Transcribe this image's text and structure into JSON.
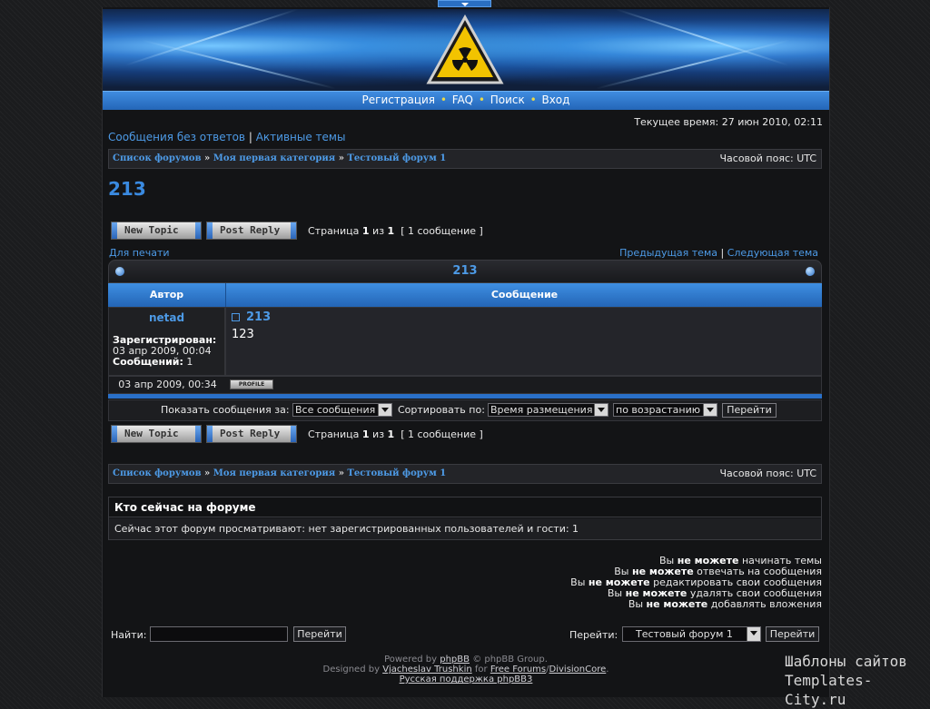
{
  "nav": {
    "register": "Регистрация",
    "faq": "FAQ",
    "search": "Поиск",
    "login": "Вход",
    "sep": "•"
  },
  "time": "Текущее время: 27 июн 2010, 02:11",
  "quick_links": {
    "unanswered": "Сообщения без ответов",
    "active": "Активные темы",
    "sep": "|"
  },
  "breadcrumb": {
    "items": [
      "Список форумов",
      "Моя первая категория",
      "Тестовый форум 1"
    ],
    "sep": "»",
    "timezone": "Часовой пояс: UTC"
  },
  "topic_title": "213",
  "buttons": {
    "new_topic": "New Topic",
    "post_reply": "Post Reply"
  },
  "pagination": {
    "page_word": "Страница",
    "current": "1",
    "of_word": "из",
    "total": "1",
    "count": "[ 1 сообщение ]"
  },
  "print_link": "Для печати",
  "topic_nav": {
    "prev": "Предыдущая тема",
    "sep": "|",
    "next": "Следующая тема"
  },
  "topic_table": {
    "header": "213",
    "col_author": "Автор",
    "col_message": "Сообщение"
  },
  "post": {
    "author": "netad",
    "registered_label": "Зарегистрирован:",
    "registered_value": "03 апр 2009, 00:04",
    "posts_label": "Сообщений:",
    "posts_value": "1",
    "subject": "213",
    "body": "123",
    "date": "03 апр 2009, 00:34",
    "profile_btn": "PROFILE"
  },
  "filters": {
    "show_label": "Показать сообщения за:",
    "show_value": "Все сообщения",
    "sort_label": "Сортировать по:",
    "sort_value": "Время размещения",
    "order_value": "по возрастанию",
    "go": "Перейти"
  },
  "online": {
    "title": "Кто сейчас на форуме",
    "text": "Сейчас этот форум просматривают: нет зарегистрированных пользователей и гости: 1"
  },
  "permissions": [
    {
      "pre": "Вы",
      "bold": "не можете",
      "post": "начинать темы"
    },
    {
      "pre": "Вы",
      "bold": "не можете",
      "post": "отвечать на сообщения"
    },
    {
      "pre": "Вы",
      "bold": "не можете",
      "post": "редактировать свои сообщения"
    },
    {
      "pre": "Вы",
      "bold": "не можете",
      "post": "удалять свои сообщения"
    },
    {
      "pre": "Вы",
      "bold": "не можете",
      "post": "добавлять вложения"
    }
  ],
  "search": {
    "label": "Найти:",
    "value": "",
    "button": "Перейти"
  },
  "jump": {
    "label": "Перейти:",
    "value": "Тестовый форум 1",
    "button": "Перейти"
  },
  "footer": {
    "powered_pre": "Powered by",
    "phpbb": "phpBB",
    "powered_post": "© phpBB Group.",
    "designed_pre": "Designed by",
    "designer": "Vjacheslav Trushkin",
    "for_word": "for",
    "free_forums": "Free Forums",
    "slash": "/",
    "division": "DivisionCore",
    "dot": ".",
    "support": "Русская поддержка phpBB3"
  },
  "watermark": {
    "line1": "Шаблоны сайтов",
    "line2": "Templates-City.ru"
  },
  "colors": {
    "accent": "#2a70c8",
    "link": "#4d9ae6",
    "page_bg": "#1b1c1e",
    "nav_dot": "#e8d84a",
    "logo_yellow": "#f2c300"
  }
}
